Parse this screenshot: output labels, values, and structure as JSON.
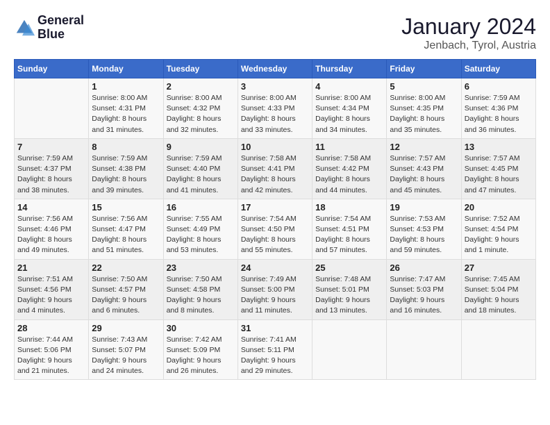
{
  "header": {
    "logo_line1": "General",
    "logo_line2": "Blue",
    "title": "January 2024",
    "subtitle": "Jenbach, Tyrol, Austria"
  },
  "calendar": {
    "days_of_week": [
      "Sunday",
      "Monday",
      "Tuesday",
      "Wednesday",
      "Thursday",
      "Friday",
      "Saturday"
    ],
    "weeks": [
      [
        {
          "day": "",
          "info": ""
        },
        {
          "day": "1",
          "info": "Sunrise: 8:00 AM\nSunset: 4:31 PM\nDaylight: 8 hours\nand 31 minutes."
        },
        {
          "day": "2",
          "info": "Sunrise: 8:00 AM\nSunset: 4:32 PM\nDaylight: 8 hours\nand 32 minutes."
        },
        {
          "day": "3",
          "info": "Sunrise: 8:00 AM\nSunset: 4:33 PM\nDaylight: 8 hours\nand 33 minutes."
        },
        {
          "day": "4",
          "info": "Sunrise: 8:00 AM\nSunset: 4:34 PM\nDaylight: 8 hours\nand 34 minutes."
        },
        {
          "day": "5",
          "info": "Sunrise: 8:00 AM\nSunset: 4:35 PM\nDaylight: 8 hours\nand 35 minutes."
        },
        {
          "day": "6",
          "info": "Sunrise: 7:59 AM\nSunset: 4:36 PM\nDaylight: 8 hours\nand 36 minutes."
        }
      ],
      [
        {
          "day": "7",
          "info": "Sunrise: 7:59 AM\nSunset: 4:37 PM\nDaylight: 8 hours\nand 38 minutes."
        },
        {
          "day": "8",
          "info": "Sunrise: 7:59 AM\nSunset: 4:38 PM\nDaylight: 8 hours\nand 39 minutes."
        },
        {
          "day": "9",
          "info": "Sunrise: 7:59 AM\nSunset: 4:40 PM\nDaylight: 8 hours\nand 41 minutes."
        },
        {
          "day": "10",
          "info": "Sunrise: 7:58 AM\nSunset: 4:41 PM\nDaylight: 8 hours\nand 42 minutes."
        },
        {
          "day": "11",
          "info": "Sunrise: 7:58 AM\nSunset: 4:42 PM\nDaylight: 8 hours\nand 44 minutes."
        },
        {
          "day": "12",
          "info": "Sunrise: 7:57 AM\nSunset: 4:43 PM\nDaylight: 8 hours\nand 45 minutes."
        },
        {
          "day": "13",
          "info": "Sunrise: 7:57 AM\nSunset: 4:45 PM\nDaylight: 8 hours\nand 47 minutes."
        }
      ],
      [
        {
          "day": "14",
          "info": "Sunrise: 7:56 AM\nSunset: 4:46 PM\nDaylight: 8 hours\nand 49 minutes."
        },
        {
          "day": "15",
          "info": "Sunrise: 7:56 AM\nSunset: 4:47 PM\nDaylight: 8 hours\nand 51 minutes."
        },
        {
          "day": "16",
          "info": "Sunrise: 7:55 AM\nSunset: 4:49 PM\nDaylight: 8 hours\nand 53 minutes."
        },
        {
          "day": "17",
          "info": "Sunrise: 7:54 AM\nSunset: 4:50 PM\nDaylight: 8 hours\nand 55 minutes."
        },
        {
          "day": "18",
          "info": "Sunrise: 7:54 AM\nSunset: 4:51 PM\nDaylight: 8 hours\nand 57 minutes."
        },
        {
          "day": "19",
          "info": "Sunrise: 7:53 AM\nSunset: 4:53 PM\nDaylight: 8 hours\nand 59 minutes."
        },
        {
          "day": "20",
          "info": "Sunrise: 7:52 AM\nSunset: 4:54 PM\nDaylight: 9 hours\nand 1 minute."
        }
      ],
      [
        {
          "day": "21",
          "info": "Sunrise: 7:51 AM\nSunset: 4:56 PM\nDaylight: 9 hours\nand 4 minutes."
        },
        {
          "day": "22",
          "info": "Sunrise: 7:50 AM\nSunset: 4:57 PM\nDaylight: 9 hours\nand 6 minutes."
        },
        {
          "day": "23",
          "info": "Sunrise: 7:50 AM\nSunset: 4:58 PM\nDaylight: 9 hours\nand 8 minutes."
        },
        {
          "day": "24",
          "info": "Sunrise: 7:49 AM\nSunset: 5:00 PM\nDaylight: 9 hours\nand 11 minutes."
        },
        {
          "day": "25",
          "info": "Sunrise: 7:48 AM\nSunset: 5:01 PM\nDaylight: 9 hours\nand 13 minutes."
        },
        {
          "day": "26",
          "info": "Sunrise: 7:47 AM\nSunset: 5:03 PM\nDaylight: 9 hours\nand 16 minutes."
        },
        {
          "day": "27",
          "info": "Sunrise: 7:45 AM\nSunset: 5:04 PM\nDaylight: 9 hours\nand 18 minutes."
        }
      ],
      [
        {
          "day": "28",
          "info": "Sunrise: 7:44 AM\nSunset: 5:06 PM\nDaylight: 9 hours\nand 21 minutes."
        },
        {
          "day": "29",
          "info": "Sunrise: 7:43 AM\nSunset: 5:07 PM\nDaylight: 9 hours\nand 24 minutes."
        },
        {
          "day": "30",
          "info": "Sunrise: 7:42 AM\nSunset: 5:09 PM\nDaylight: 9 hours\nand 26 minutes."
        },
        {
          "day": "31",
          "info": "Sunrise: 7:41 AM\nSunset: 5:11 PM\nDaylight: 9 hours\nand 29 minutes."
        },
        {
          "day": "",
          "info": ""
        },
        {
          "day": "",
          "info": ""
        },
        {
          "day": "",
          "info": ""
        }
      ]
    ]
  }
}
